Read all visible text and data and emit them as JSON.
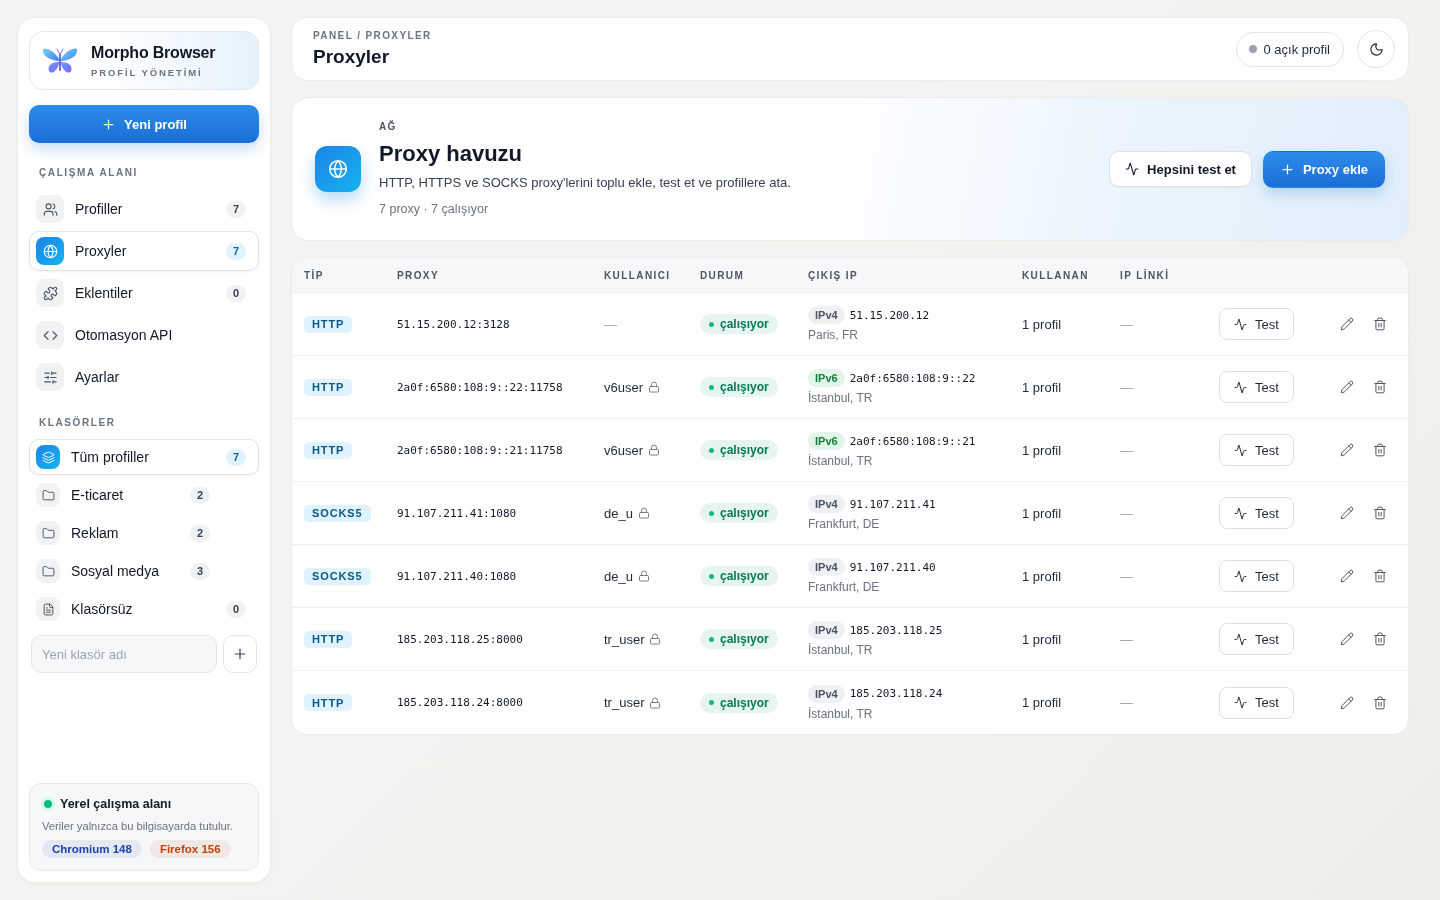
{
  "sidebar": {
    "brand": {
      "name": "Morpho Browser",
      "subtitle": "PROFİL YÖNETİMİ"
    },
    "new_profile_button": "Yeni profil",
    "workspace": {
      "heading": "ÇALIŞMA ALANI",
      "items": [
        {
          "label": "Profiller",
          "count": "7",
          "selected": false
        },
        {
          "label": "Proxyler",
          "count": "7",
          "selected": true
        },
        {
          "label": "Eklentiler",
          "count": "0",
          "selected": false
        },
        {
          "label": "Otomasyon API",
          "selected": false
        },
        {
          "label": "Ayarlar",
          "selected": false
        }
      ]
    },
    "folders": {
      "heading": "KLASÖRLER",
      "items": [
        {
          "kind": "all",
          "label": "Tüm profiller",
          "count": "7",
          "selected": true
        },
        {
          "kind": "folder",
          "label": "E-ticaret",
          "count": "2",
          "selected": false
        },
        {
          "kind": "folder",
          "label": "Reklam",
          "count": "2",
          "selected": false
        },
        {
          "kind": "folder",
          "label": "Sosyal medya",
          "count": "3",
          "selected": false
        },
        {
          "kind": "unfiled",
          "label": "Klasörsüz",
          "count": "0",
          "selected": false
        }
      ],
      "new_folder_field": {
        "placeholder": "Yeni klasör adı"
      }
    },
    "workspace_card": {
      "title": "Yerel çalışma alanı",
      "description": "Veriler yalnızca bu bilgisayarda tutulur.",
      "tags": [
        {
          "label": "Chromium 148",
          "color": "#1e40af"
        },
        {
          "label": "Firefox 156",
          "color": "#c2410c"
        }
      ]
    }
  },
  "header": {
    "breadcrumb": "PANEL / PROXYLER",
    "title": "Proxyler",
    "open_profiles": "0 açık profil"
  },
  "pool": {
    "eyebrow": "AĞ",
    "title": "Proxy havuzu",
    "description": "HTTP, HTTPS ve SOCKS proxy'lerini toplu ekle, test et ve profillere ata.",
    "stats": "7 proxy · 7 çalışıyor",
    "buttons": [
      {
        "kind": "secondary",
        "label": "Hepsini test et"
      },
      {
        "kind": "primary",
        "label": "Proxy ekle"
      }
    ]
  },
  "table": {
    "columns": [
      "TİP",
      "PROXY",
      "KULLANICI",
      "DURUM",
      "ÇIKIŞ IP",
      "KULLANAN",
      "IP LİNKİ"
    ],
    "rows": [
      {
        "type": "HTTP",
        "proxy": "51.15.200.12:3128",
        "user": "—",
        "locked": false,
        "status": "çalışıyor",
        "exit_ip": {
          "kind": "ipv4",
          "version": "IPv4",
          "address": "51.15.200.12",
          "location": "Paris, FR"
        },
        "used_by": "1 profil",
        "ip_link": "—",
        "test_button": "Test"
      },
      {
        "type": "HTTP",
        "proxy": "2a0f:6580:108:9::22:11758",
        "user": "v6user",
        "locked": true,
        "status": "çalışıyor",
        "exit_ip": {
          "kind": "ipv6",
          "version": "IPv6",
          "address": "2a0f:6580:108:9::22",
          "location": "İstanbul, TR"
        },
        "used_by": "1 profil",
        "ip_link": "—",
        "test_button": "Test"
      },
      {
        "type": "HTTP",
        "proxy": "2a0f:6580:108:9::21:11758",
        "user": "v6user",
        "locked": true,
        "status": "çalışıyor",
        "exit_ip": {
          "kind": "ipv6",
          "version": "IPv6",
          "address": "2a0f:6580:108:9::21",
          "location": "İstanbul, TR"
        },
        "used_by": "1 profil",
        "ip_link": "—",
        "test_button": "Test"
      },
      {
        "type": "SOCKS5",
        "proxy": "91.107.211.41:1080",
        "user": "de_u",
        "locked": true,
        "status": "çalışıyor",
        "exit_ip": {
          "kind": "ipv4",
          "version": "IPv4",
          "address": "91.107.211.41",
          "location": "Frankfurt, DE"
        },
        "used_by": "1 profil",
        "ip_link": "—",
        "test_button": "Test"
      },
      {
        "type": "SOCKS5",
        "proxy": "91.107.211.40:1080",
        "user": "de_u",
        "locked": true,
        "status": "çalışıyor",
        "exit_ip": {
          "kind": "ipv4",
          "version": "IPv4",
          "address": "91.107.211.40",
          "location": "Frankfurt, DE"
        },
        "used_by": "1 profil",
        "ip_link": "—",
        "test_button": "Test"
      },
      {
        "type": "HTTP",
        "proxy": "185.203.118.25:8000",
        "user": "tr_user",
        "locked": true,
        "status": "çalışıyor",
        "exit_ip": {
          "kind": "ipv4",
          "version": "IPv4",
          "address": "185.203.118.25",
          "location": "İstanbul, TR"
        },
        "used_by": "1 profil",
        "ip_link": "—",
        "test_button": "Test"
      },
      {
        "type": "HTTP",
        "proxy": "185.203.118.24:8000",
        "user": "tr_user",
        "locked": true,
        "status": "çalışıyor",
        "exit_ip": {
          "kind": "ipv4",
          "version": "IPv4",
          "address": "185.203.118.24",
          "location": "İstanbul, TR"
        },
        "used_by": "1 profil",
        "ip_link": "—",
        "test_button": "Test"
      }
    ]
  }
}
